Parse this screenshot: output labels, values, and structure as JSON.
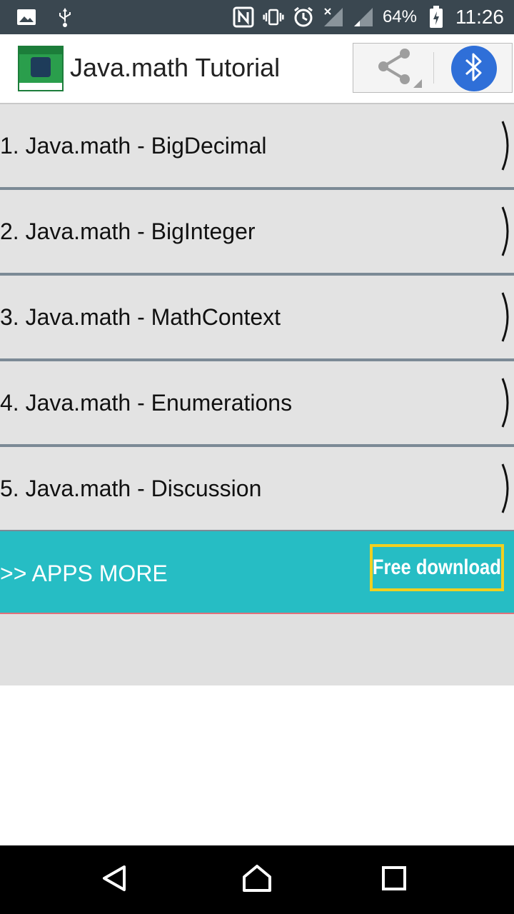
{
  "status_bar": {
    "icons_left": [
      "image-icon",
      "usb-icon"
    ],
    "icons_right": [
      "nfc-icon",
      "vibrate-icon",
      "alarm-icon",
      "signal-icon",
      "signal-icon"
    ],
    "battery_percent": "64%",
    "time": "11:26"
  },
  "app_bar": {
    "title": "Java.math Tutorial",
    "share_icon": "share-icon",
    "bluetooth_icon": "bluetooth-icon",
    "accent_color": "#2f6fd8"
  },
  "list": {
    "items": [
      {
        "label": "1. Java.math - BigDecimal"
      },
      {
        "label": "2. Java.math - BigInteger"
      },
      {
        "label": "3. Java.math - MathContext"
      },
      {
        "label": "4. Java.math - Enumerations"
      },
      {
        "label": "5. Java.math - Discussion"
      }
    ]
  },
  "banner": {
    "label": ">> APPS MORE",
    "button_label": "Free download",
    "background_color": "#26bdc4",
    "button_border_color": "#f0d020"
  },
  "nav_bar": {
    "icons": [
      "back-icon",
      "home-icon",
      "recents-icon"
    ]
  }
}
